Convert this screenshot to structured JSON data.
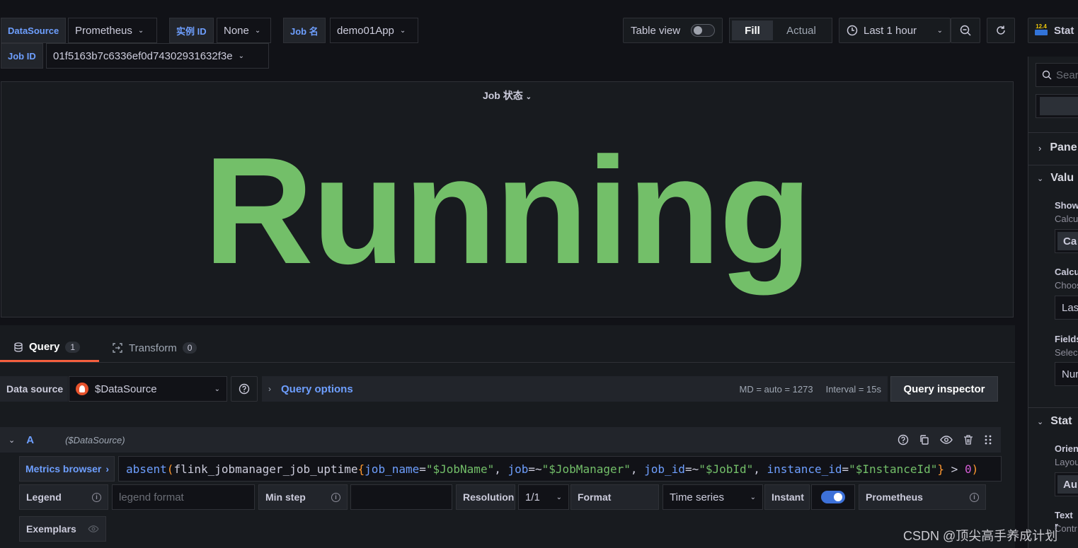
{
  "variables": {
    "datasource": {
      "label": "DataSource",
      "value": "Prometheus"
    },
    "instance_id": {
      "label": "实例 ID",
      "value": "None"
    },
    "job_name": {
      "label": "Job 名",
      "value": "demo01App"
    },
    "job_id": {
      "label": "Job ID",
      "value": "01f5163b7c6336ef0d74302931632f3e"
    }
  },
  "toolbar": {
    "table_view": "Table view",
    "fill": "Fill",
    "actual": "Actual",
    "time_range": "Last 1 hour",
    "viz_badge": "12.4",
    "viz_name": "Stat"
  },
  "panel": {
    "title": "Job 状态",
    "value": "Running",
    "value_color": "#73bf69"
  },
  "tabs": {
    "query": {
      "label": "Query",
      "count": "1"
    },
    "transform": {
      "label": "Transform",
      "count": "0"
    }
  },
  "query_bar": {
    "datasource_label": "Data source",
    "datasource_value": "$DataSource",
    "query_options": "Query options",
    "md": "MD = auto = 1273",
    "interval": "Interval = 15s",
    "inspector": "Query inspector"
  },
  "query_row": {
    "ref_id": "A",
    "datasource": "($DataSource)",
    "metrics_browser": "Metrics browser",
    "expr": {
      "fn": "absent",
      "metric": "flink_jobmanager_job_uptime",
      "l1": "job_name",
      "op1": "=",
      "v1": "\"$JobName\"",
      "l2": "job",
      "op2": "=~",
      "v2": "\"$JobManager\"",
      "l3": "job_id",
      "op3": "=~",
      "v3": "\"$JobId\"",
      "l4": "instance_id",
      "op4": "=",
      "v4": "\"$InstanceId\"",
      "cmp": ">",
      "num": "0",
      "open_paren": "(",
      "close_paren": ")",
      "open_brace": "{",
      "close_brace": "}",
      "sep": ", "
    }
  },
  "options": {
    "legend_label": "Legend",
    "legend_placeholder": "legend format",
    "min_step_label": "Min step",
    "resolution_label": "Resolution",
    "resolution_value": "1/1",
    "format_label": "Format",
    "format_value": "Time series",
    "instant_label": "Instant",
    "prometheus_label": "Prometheus",
    "exemplars_label": "Exemplars"
  },
  "sidebar": {
    "search_placeholder": "Sear",
    "panel_options": "Pane",
    "value_options": "Valu",
    "show_label": "Show",
    "show_sub": "Calcu",
    "show_btn": "Ca",
    "calc_label": "Calcu",
    "calc_sub": "Choos",
    "calc_value": "Las",
    "fields_label": "Fields",
    "fields_sub": "Selec",
    "fields_value": "Nur",
    "stat_styles": "Stat",
    "orient_label": "Orien",
    "orient_sub": "Layou",
    "orient_btn": "Au",
    "text_label": "Text r",
    "text_sub": "Contr"
  },
  "watermark": "CSDN @顶尖高手养成计划"
}
